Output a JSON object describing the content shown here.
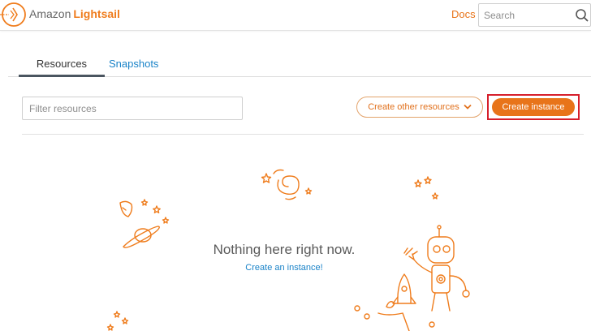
{
  "header": {
    "brand_prefix": "Amazon",
    "brand_name": "Lightsail",
    "docs_label": "Docs",
    "search_placeholder": "Search"
  },
  "tabs": [
    {
      "label": "Resources",
      "active": true
    },
    {
      "label": "Snapshots",
      "active": false
    }
  ],
  "controls": {
    "filter_placeholder": "Filter resources",
    "create_other_label": "Create other resources",
    "create_instance_label": "Create instance"
  },
  "empty_state": {
    "message": "Nothing here right now.",
    "link": "Create an instance!"
  },
  "colors": {
    "accent": "#e8741a",
    "link": "#1a83c8",
    "highlight": "#d61f2b"
  }
}
